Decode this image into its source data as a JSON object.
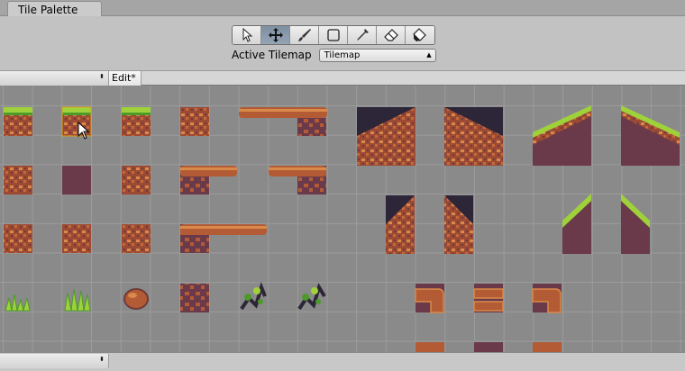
{
  "window": {
    "tab_title": "Tile Palette"
  },
  "toolbar": {
    "tools": [
      {
        "name": "select",
        "icon": "arrow-select-icon",
        "active": false
      },
      {
        "name": "move",
        "icon": "move-icon",
        "active": true
      },
      {
        "name": "paint",
        "icon": "brush-icon",
        "active": false
      },
      {
        "name": "box-fill",
        "icon": "rectangle-icon",
        "active": false
      },
      {
        "name": "picker",
        "icon": "eyedropper-icon",
        "active": false
      },
      {
        "name": "erase",
        "icon": "eraser-icon",
        "active": false
      },
      {
        "name": "fill",
        "icon": "fill-bucket-icon",
        "active": false
      }
    ],
    "active_tilemap_label": "Active Tilemap",
    "active_tilemap_value": "Tilemap"
  },
  "palette_bar": {
    "palette_value": "",
    "edit_label": "Edit*"
  },
  "brush_bar": {
    "brush_value": ""
  },
  "colors": {
    "dirt": "#b35b34",
    "dirt_light": "#d98a4a",
    "dirt_dark": "#6e3a3a",
    "purple_bg": "#6b3a4a",
    "grass": "#9fd23a",
    "grass_dark": "#4c9a2a",
    "sky_dark": "#2d2638"
  }
}
